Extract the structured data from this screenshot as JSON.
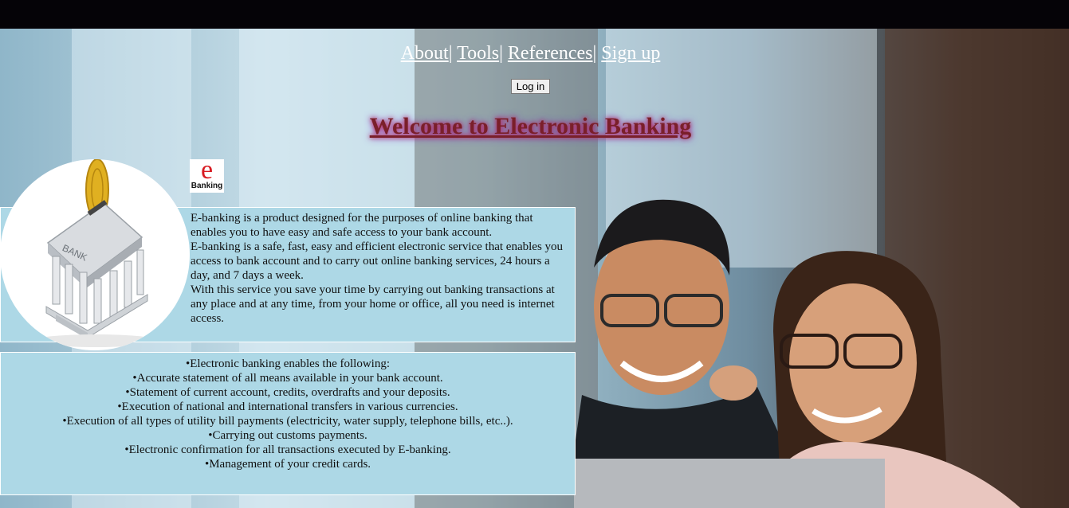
{
  "nav": {
    "links": [
      "About",
      "Tools",
      "References",
      "Sign up"
    ],
    "separator": "|"
  },
  "login_label": "Log in",
  "welcome_title": "Welcome to Electronic Banking",
  "logo": {
    "letter": "e",
    "label": "Banking"
  },
  "bank_image": {
    "icon": "piggy-bank-building-icon",
    "sign": "BANK"
  },
  "intro": {
    "p1": "E-banking is a product designed for the purposes of online banking that enables you to have easy and safe access to your bank account.",
    "p2": "E-banking is a safe, fast, easy and efficient electronic service that enables you access to bank account and to carry out online banking services, 24 hours a day, and 7 days a week.",
    "p3": "With this service you save your time by carrying out banking transactions at any place and at any time, from your home or office, all you need is internet access."
  },
  "features": [
    "•Electronic banking enables the following:",
    "•Accurate statement of all means available in your bank account.",
    "•Statement of current account, credits, overdrafts and your deposits.",
    "•Execution of national and international transfers in various currencies.",
    "•Execution of all types of utility bill payments (electricity, water supply, telephone bills, etc..).",
    "•Carrying out customs payments.",
    "•Electronic confirmation for all transactions executed by E-banking.",
    "•Management of your credit cards."
  ],
  "colors": {
    "panel": "#add8e6",
    "title": "#7a1f2a",
    "title_glow": "#c22246",
    "logo_red": "#d81b22",
    "topbar": "#050307"
  }
}
